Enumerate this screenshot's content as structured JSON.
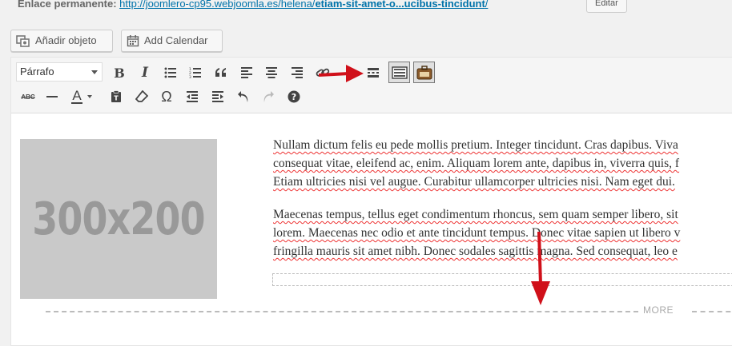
{
  "permalink": {
    "label": "Enlace permanente:",
    "url_prefix": "http://joomlero-cp95.webjoomla.es/helena/",
    "slug": "etiam-sit-amet-o...ucibus-tincidunt",
    "trail": "/",
    "edit_label": "Editar"
  },
  "media_buttons": {
    "add_object": "Añadir objeto",
    "add_calendar": "Add Calendar"
  },
  "toolbar": {
    "format_value": "Párrafo",
    "row1_icons": [
      "bold-icon",
      "italic-icon",
      "bullet-list-icon",
      "numbered-list-icon",
      "blockquote-icon",
      "align-left-icon",
      "align-center-icon",
      "align-right-icon",
      "link-icon",
      "unlink-icon",
      "read-more-icon",
      "toolbar-toggle-icon",
      "plugin-icon"
    ],
    "row2_icons": [
      "strikethrough-icon",
      "horizontal-line-icon",
      "text-color-icon",
      "paste-text-icon",
      "clear-formatting-icon",
      "special-character-icon",
      "outdent-icon",
      "indent-icon",
      "undo-icon",
      "redo-icon",
      "help-icon"
    ],
    "bold_glyph": "B",
    "italic_glyph": "I",
    "text_color_glyph": "A",
    "omega_glyph": "Ω",
    "strike_glyph": "ABC"
  },
  "content": {
    "image_text": "300x200",
    "p1_l1_a": "Nullam dictum felis eu pede mollis pretium. Integer tincidunt. Cras dapibus. Viva",
    "p1_l2": "consequat vitae, eleifend ac, enim. Aliquam lorem ante, dapibus in, viverra quis, f",
    "p1_l3": "Etiam ultricies nisi vel augue. Curabitur ullamcorper ultricies nisi. Nam eget dui.",
    "p2_l1": "Maecenas tempus, tellus eget condimentum rhoncus, sem quam semper libero, sit",
    "p2_l2": "lorem. Maecenas nec odio et ante tincidunt tempus. Donec vitae sapien ut libero v",
    "p2_l3": "fringilla mauris sit amet nibh. Donec sodales sagittis magna. Sed consequat, leo e",
    "more_label": "MORE"
  },
  "colors": {
    "arrow": "#d0101a",
    "link": "#0073aa"
  }
}
